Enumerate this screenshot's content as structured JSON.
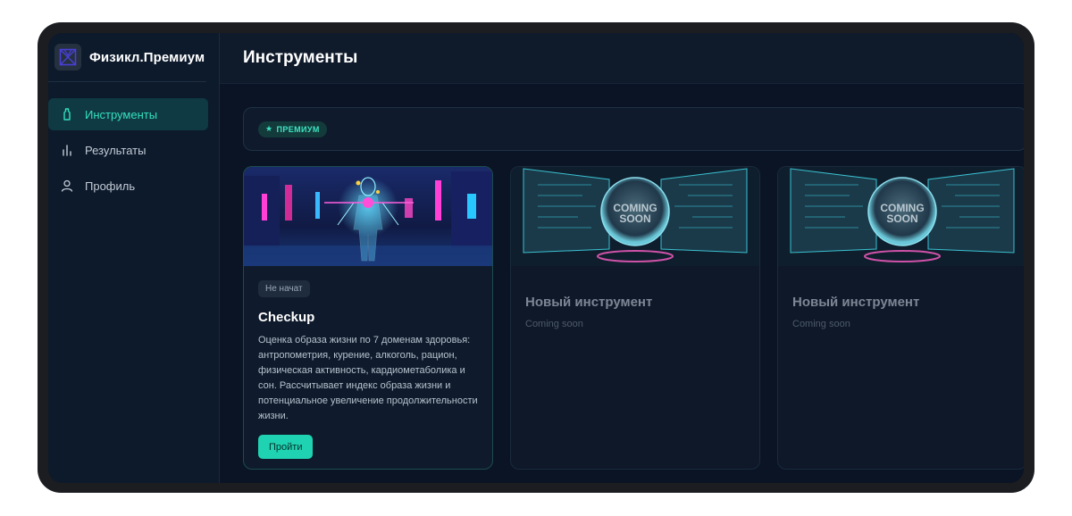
{
  "app": {
    "name": "Физикл.Премиум"
  },
  "sidebar": {
    "items": [
      {
        "label": "Инструменты",
        "icon": "bottle-icon",
        "active": true
      },
      {
        "label": "Результаты",
        "icon": "bar-chart-icon",
        "active": false
      },
      {
        "label": "Профиль",
        "icon": "user-icon",
        "active": false
      }
    ]
  },
  "header": {
    "title": "Инструменты"
  },
  "filter": {
    "badge": "ПРЕМИУМ"
  },
  "cards": [
    {
      "status": "Не начат",
      "title": "Checkup",
      "description": "Оценка образа жизни по 7 доменам здоровья: антропометрия, курение, алкоголь, рацион, физическая активность, кардиометаболика и сон. Рассчитывает индекс образа жизни и потенциальное увеличение продолжительности жизни.",
      "button": "Пройти"
    },
    {
      "image_text": [
        "COMING",
        "SOON"
      ],
      "title": "Новый инструмент",
      "subtitle": "Coming soon"
    },
    {
      "image_text": [
        "COMING",
        "SOON"
      ],
      "title": "Новый инструмент",
      "subtitle": "Coming soon"
    }
  ],
  "colors": {
    "accent": "#1fd3b2",
    "background": "#0b1424",
    "sidebar": "#0d1a2b"
  }
}
